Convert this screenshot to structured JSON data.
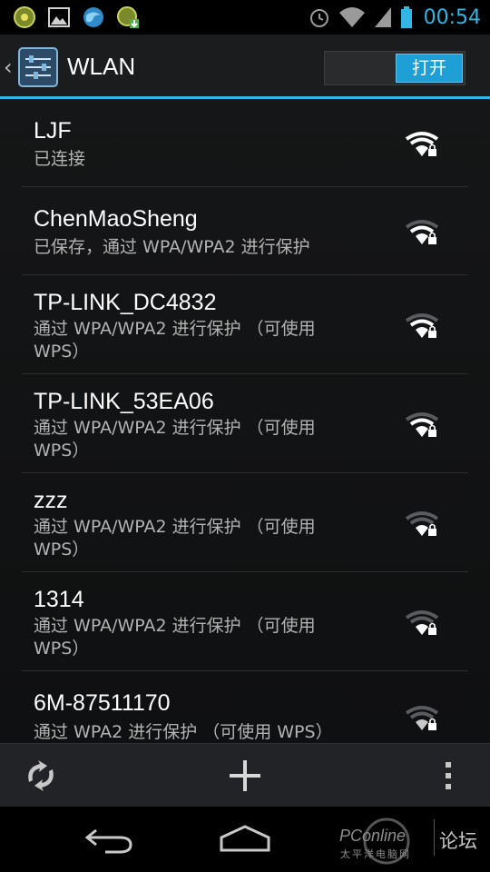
{
  "status_bar": {
    "time": "00:54",
    "notification_icons": [
      "app-notification-icon",
      "image-notification-icon",
      "browser-notification-icon",
      "download-notification-icon"
    ],
    "system_icons": [
      "alarm-icon",
      "wifi-signal-icon",
      "cell-signal-icon",
      "battery-icon"
    ]
  },
  "action_bar": {
    "title": "WLAN",
    "toggle_label": "打开",
    "accent_color": "#33b5e5"
  },
  "networks": [
    {
      "ssid": "LJF",
      "summary": "已连接"
    },
    {
      "ssid": "ChenMaoSheng",
      "summary": "已保存，通过 WPA/WPA2 进行保护"
    },
    {
      "ssid": "TP-LINK_DC4832",
      "summary": "通过 WPA/WPA2 进行保护 （可使用 WPS）"
    },
    {
      "ssid": "TP-LINK_53EA06",
      "summary": "通过 WPA/WPA2 进行保护 （可使用 WPS）"
    },
    {
      "ssid": "zzz",
      "summary": "通过 WPA/WPA2 进行保护 （可使用 WPS）"
    },
    {
      "ssid": "1314",
      "summary": "通过 WPA/WPA2 进行保护 （可使用 WPS）"
    },
    {
      "ssid": "6M-87511170",
      "summary": "通过 WPA2 进行保护 （可使用 WPS）"
    }
  ],
  "bottom_bar": {
    "icons": [
      "scan-icon",
      "add-network-icon",
      "overflow-menu-icon"
    ]
  },
  "nav_bar": {
    "icons": [
      "back-icon",
      "home-icon"
    ]
  },
  "watermark": {
    "brand": "PConline",
    "sub": "太平洋电脑网",
    "forum": "论坛"
  }
}
